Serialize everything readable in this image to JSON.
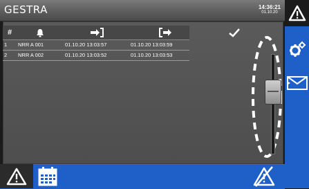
{
  "app": {
    "brand": "GESTRA",
    "time": "14:36:21",
    "date": "01.10.20"
  },
  "table": {
    "headers": {
      "number": "#",
      "alarm_icon": "bell-icon",
      "come_icon": "enter-icon",
      "go_icon": "exit-icon",
      "ack_icon": "checkmark-icon"
    },
    "rows": [
      {
        "num": "1",
        "name": "NRR A 001",
        "come": "01.10.20   13:03:57",
        "go": "01.10.20   13:03:59"
      },
      {
        "num": "2",
        "name": "NRR A 002",
        "come": "01.10.20   13:03:52",
        "go": "01.10.20   13:03:53"
      }
    ]
  },
  "slider": {
    "position": 0.34
  },
  "sidebar": {
    "buttons": [
      "warning-icon",
      "settings-icon",
      "mail-icon"
    ]
  },
  "bottombar": {
    "buttons": [
      "warning-icon",
      "calendar-icon",
      "warning-slashed-icon"
    ]
  },
  "colors": {
    "accent_blue": "#1f5fc8",
    "panel_grey": "#555555"
  }
}
